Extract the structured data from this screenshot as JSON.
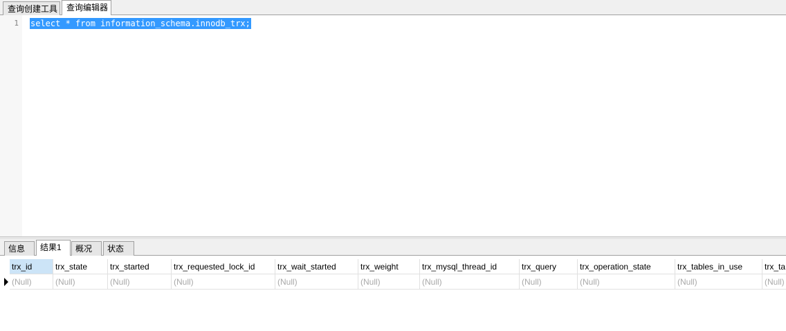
{
  "top_tabs": [
    {
      "label": "查询创建工具",
      "active": false
    },
    {
      "label": "查询编辑器",
      "active": true
    }
  ],
  "editor": {
    "line_number": "1",
    "code": "select * from information_schema.innodb_trx;"
  },
  "result_tabs": [
    {
      "label": "信息",
      "active": false
    },
    {
      "label": "结果1",
      "active": true
    },
    {
      "label": "概况",
      "active": false
    },
    {
      "label": "状态",
      "active": false
    }
  ],
  "grid": {
    "columns": [
      "trx_id",
      "trx_state",
      "trx_started",
      "trx_requested_lock_id",
      "trx_wait_started",
      "trx_weight",
      "trx_mysql_thread_id",
      "trx_query",
      "trx_operation_state",
      "trx_tables_in_use",
      "trx_ta"
    ],
    "rows": [
      [
        "(Null)",
        "(Null)",
        "(Null)",
        "(Null)",
        "(Null)",
        "(Null)",
        "(Null)",
        "(Null)",
        "(Null)",
        "(Null)",
        "(Null)"
      ]
    ]
  },
  "colors": {
    "selection": "#3399ff",
    "null_text": "#a8a8a8",
    "header_selected": "#cce4f7"
  }
}
